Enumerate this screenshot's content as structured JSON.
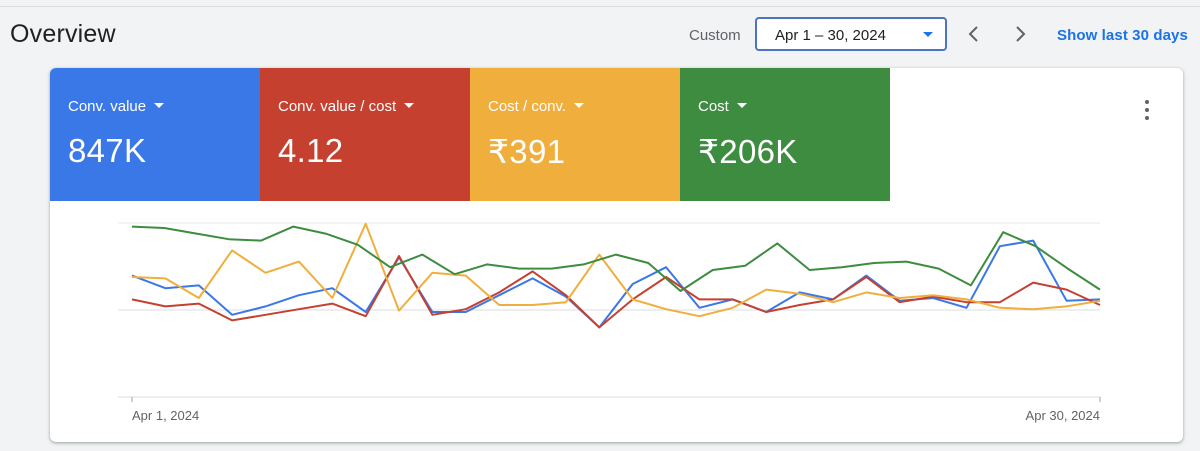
{
  "header": {
    "title": "Overview",
    "custom_label": "Custom",
    "date_range": "Apr 1 – 30, 2024",
    "show_last": "Show last 30 days"
  },
  "colors": {
    "blue": "#3b78e7",
    "red": "#c5402f",
    "yellow": "#f0ae3c",
    "green": "#3d8c40",
    "accent": "#1a73e8"
  },
  "metrics": [
    {
      "label": "Conv. value",
      "value": "847K",
      "color": "#3b78e7"
    },
    {
      "label": "Conv. value / cost",
      "value": "4.12",
      "color": "#c5402f"
    },
    {
      "label": "Cost / conv.",
      "value": "₹391",
      "color": "#f0ae3c"
    },
    {
      "label": "Cost",
      "value": "₹206K",
      "color": "#3d8c40"
    }
  ],
  "chart_data": {
    "type": "line",
    "x_start_label": "Apr 1, 2024",
    "x_end_label": "Apr 30, 2024",
    "grid": true,
    "series": [
      {
        "color": "#3b78e7",
        "values": [
          0.39,
          0.48,
          0.46,
          0.67,
          0.61,
          0.53,
          0.48,
          0.65,
          0.26,
          0.65,
          0.65,
          0.53,
          0.41,
          0.54,
          0.76,
          0.45,
          0.33,
          0.62,
          0.56,
          0.65,
          0.51,
          0.56,
          0.39,
          0.57,
          0.55,
          0.62,
          0.18,
          0.14,
          0.57,
          0.56
        ]
      },
      {
        "color": "#c5402f",
        "values": [
          0.56,
          0.61,
          0.59,
          0.71,
          0.67,
          0.63,
          0.59,
          0.68,
          0.25,
          0.67,
          0.63,
          0.51,
          0.36,
          0.53,
          0.76,
          0.56,
          0.4,
          0.56,
          0.56,
          0.65,
          0.6,
          0.56,
          0.4,
          0.58,
          0.54,
          0.58,
          0.58,
          0.44,
          0.49,
          0.6
        ]
      },
      {
        "color": "#f0ae3c",
        "values": [
          0.4,
          0.41,
          0.55,
          0.21,
          0.37,
          0.29,
          0.55,
          0.02,
          0.64,
          0.37,
          0.39,
          0.6,
          0.6,
          0.58,
          0.24,
          0.56,
          0.63,
          0.68,
          0.62,
          0.49,
          0.52,
          0.58,
          0.51,
          0.55,
          0.53,
          0.56,
          0.62,
          0.63,
          0.61,
          0.57
        ]
      },
      {
        "color": "#3d8c40",
        "values": [
          0.04,
          0.05,
          0.09,
          0.13,
          0.14,
          0.04,
          0.09,
          0.17,
          0.33,
          0.24,
          0.38,
          0.31,
          0.34,
          0.34,
          0.31,
          0.24,
          0.3,
          0.5,
          0.35,
          0.32,
          0.16,
          0.35,
          0.33,
          0.3,
          0.29,
          0.34,
          0.46,
          0.08,
          0.18,
          0.34,
          0.49
        ]
      }
    ]
  }
}
